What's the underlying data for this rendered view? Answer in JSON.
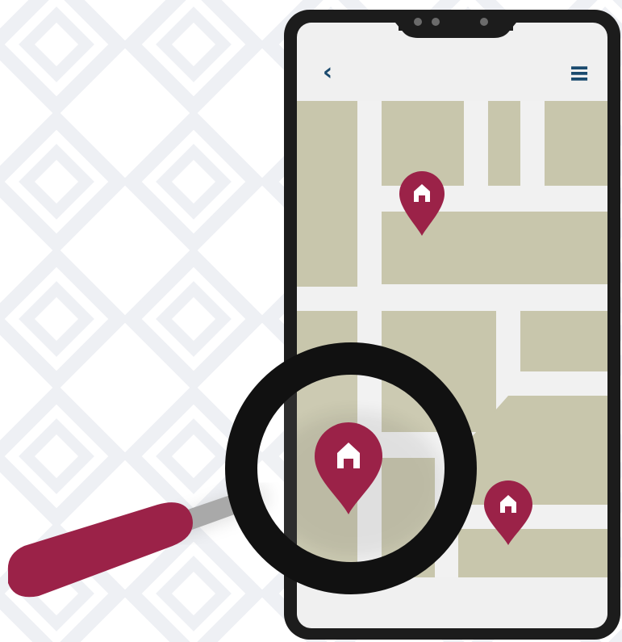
{
  "colors": {
    "background": "#ffffff",
    "pattern": "#eef0f4",
    "phone_frame": "#1c1c1c",
    "screen_bg": "#f0f0f0",
    "map_road": "#f1f1f1",
    "map_block": "#c8c6ac",
    "accent": "#9b2248",
    "nav_icon": "#1a4a6e",
    "handle_shaft": "#a9a9a9"
  },
  "header": {
    "back_glyph": "‹",
    "menu_glyph": "≡"
  },
  "map": {
    "markers": [
      {
        "icon": "home-icon",
        "state": "normal"
      },
      {
        "icon": "home-icon",
        "state": "highlighted"
      },
      {
        "icon": "home-icon",
        "state": "normal"
      }
    ]
  },
  "illustration": {
    "magnifier": "magnifying-glass-icon"
  }
}
